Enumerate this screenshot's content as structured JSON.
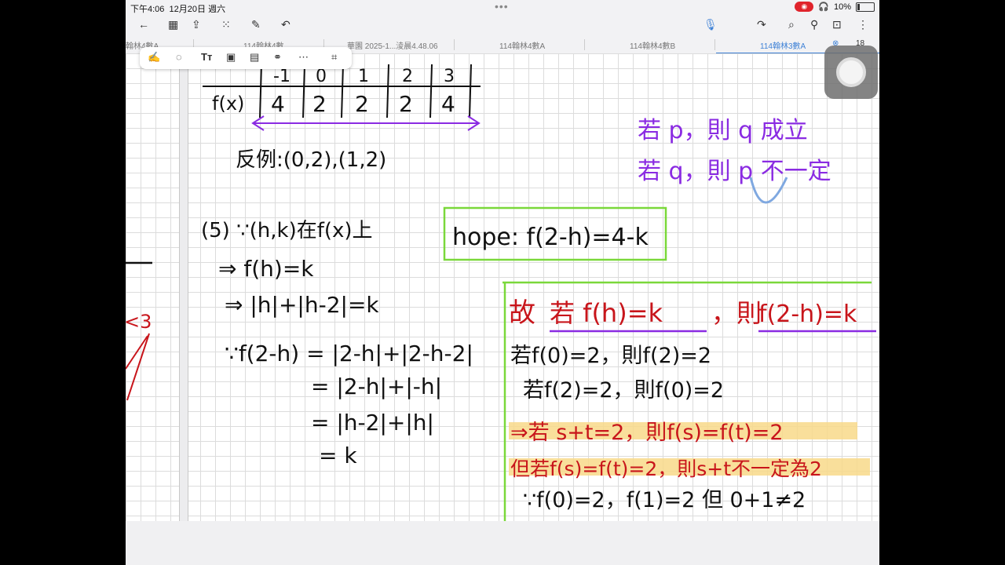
{
  "status": {
    "time": "下午4:06",
    "date": "12月20日 週六",
    "battery": "10%"
  },
  "tabs": [
    "翰林4數A",
    "114翰林4數",
    "華園 2025-1...淩晨4.48.06",
    "114翰林4數A",
    "114翰林4數B",
    "114翰林3數A"
  ],
  "page_count": "18",
  "notes": {
    "table_row_x": [
      "-1",
      "0",
      "1",
      "2",
      "3"
    ],
    "table_fx": "f(x)",
    "table_row_fx": [
      "4",
      "2",
      "2",
      "2",
      "4"
    ],
    "counterexample": "反例:(0,2),(1,2)",
    "step5": "(5) ∵(h,k)在f(x)上",
    "step5_a": "⇒ f(h)=k",
    "step5_b": "⇒ |h|+|h-2|=k",
    "calc_1": "∵f(2-h) = |2-h|+|2-h-2|",
    "calc_2": "= |2-h|+|-h|",
    "calc_3": "= |h-2|+|h|",
    "calc_4": "= k",
    "hope": "hope: f(2-h)=4-k",
    "rule_1": "若 p，則 q 成立",
    "rule_2": "若 q，則 p 不一定",
    "left_fragment_1": "<3",
    "box_title_a": "故",
    "box_title_b": "若 f(h)=k",
    "box_title_c": "，則",
    "box_title_d": "f(2-h)=k",
    "box_l1": "若f(0)=2，則f(2)=2",
    "box_l2": "若f(2)=2，則f(0)=2",
    "box_l3": "⇒若 s+t=2，則f(s)=f(t)=2",
    "box_l4": "但若f(s)=f(t)=2，則s+t不一定為2",
    "box_l5": "∵f(0)=2，f(1)=2 但 0+1≠2"
  },
  "colors": {
    "ink": "#111111",
    "purple": "#8a2be2",
    "red": "#c8151b",
    "green": "#7ad83a",
    "highlight": "#f8d98a",
    "blue": "#7fa8e0",
    "accent": "#3f82d6"
  }
}
